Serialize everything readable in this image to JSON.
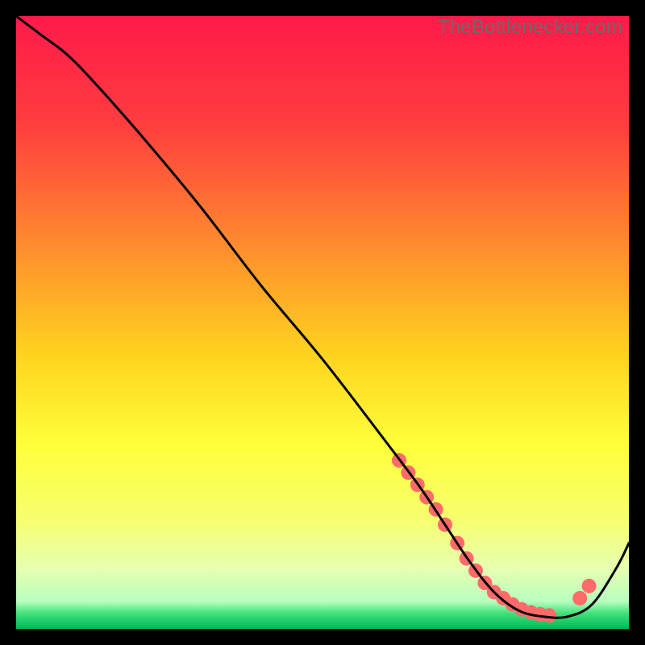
{
  "watermark": "TheBottlenecker.com",
  "gradient": {
    "stops": [
      {
        "offset": 0.0,
        "color": "#ff1a4b"
      },
      {
        "offset": 0.18,
        "color": "#ff3e3e"
      },
      {
        "offset": 0.38,
        "color": "#ff8e2e"
      },
      {
        "offset": 0.55,
        "color": "#ffd21f"
      },
      {
        "offset": 0.7,
        "color": "#ffff3a"
      },
      {
        "offset": 0.82,
        "color": "#f7ff6e"
      },
      {
        "offset": 0.9,
        "color": "#e8ffb0"
      },
      {
        "offset": 0.955,
        "color": "#b8ffc0"
      },
      {
        "offset": 0.975,
        "color": "#40e07a"
      },
      {
        "offset": 1.0,
        "color": "#00b85a"
      }
    ]
  },
  "chart_data": {
    "type": "line",
    "title": "",
    "xlabel": "",
    "ylabel": "",
    "xlim": [
      0,
      100
    ],
    "ylim": [
      0,
      100
    ],
    "series": [
      {
        "name": "curve",
        "x": [
          0,
          4,
          8,
          12,
          20,
          30,
          40,
          50,
          60,
          66,
          70,
          74,
          78,
          82,
          86,
          90,
          94,
          98,
          100
        ],
        "y": [
          100,
          97,
          94,
          90,
          81,
          69,
          56,
          44,
          31,
          23,
          17,
          11,
          6,
          3,
          2,
          2,
          4,
          10,
          14
        ]
      }
    ],
    "markers": {
      "name": "dots",
      "x": [
        62.5,
        64,
        65.5,
        67,
        68.5,
        70,
        72,
        73.5,
        75,
        76.5,
        78,
        79.5,
        81,
        82.5,
        84,
        85.5,
        87,
        92,
        93.5
      ],
      "y": [
        27.5,
        25.5,
        23.5,
        21.5,
        19.5,
        17,
        14,
        11.5,
        9.5,
        7.5,
        6,
        5,
        4,
        3.2,
        2.7,
        2.4,
        2.2,
        5,
        7
      ],
      "color": "#ff6b6b",
      "radius": 9
    }
  }
}
